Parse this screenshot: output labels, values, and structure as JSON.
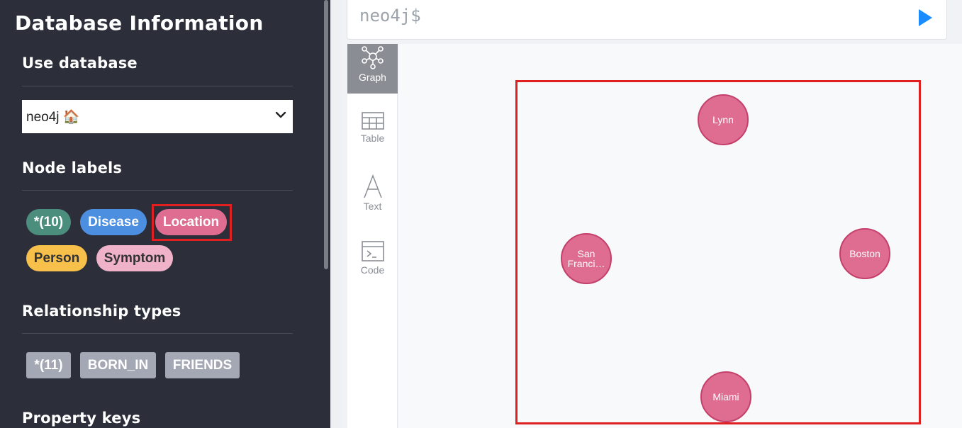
{
  "sidebar": {
    "title": "Database Information",
    "use_database": {
      "heading": "Use database",
      "selected": "neo4j 🏠"
    },
    "node_labels": {
      "heading": "Node labels",
      "items": [
        {
          "label": "*(10)",
          "color": "#4c8e7e"
        },
        {
          "label": "Disease",
          "color": "#4c8ee0"
        },
        {
          "label": "Location",
          "color": "#de6d91"
        },
        {
          "label": "Person",
          "color": "#f7c04a"
        },
        {
          "label": "Symptom",
          "color": "#f0b2c8"
        }
      ]
    },
    "relationship_types": {
      "heading": "Relationship types",
      "items": [
        {
          "label": "*(11)"
        },
        {
          "label": "BORN_IN"
        },
        {
          "label": "FRIENDS"
        }
      ]
    },
    "property_keys": {
      "heading": "Property keys"
    }
  },
  "editor": {
    "prompt": "neo4j$",
    "run_icon": "play-icon",
    "run_color": "#1a8cff"
  },
  "view_tabs": [
    {
      "label": "Graph",
      "icon": "graph-icon",
      "active": true
    },
    {
      "label": "Table",
      "icon": "table-icon",
      "active": false
    },
    {
      "label": "Text",
      "icon": "text-icon",
      "active": false
    },
    {
      "label": "Code",
      "icon": "code-icon",
      "active": false
    }
  ],
  "graph": {
    "node_color": "#de6d91",
    "nodes": [
      {
        "label": "Lynn"
      },
      {
        "label": "San Franci…"
      },
      {
        "label": "Boston"
      },
      {
        "label": "Miami"
      }
    ]
  },
  "highlight_color": "#e02020"
}
